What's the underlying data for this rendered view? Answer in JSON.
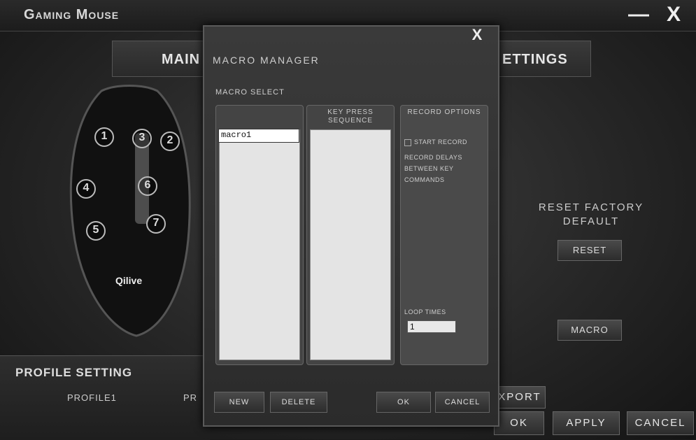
{
  "app": {
    "title": "Gaming Mouse",
    "minimize": "—",
    "close": "X"
  },
  "tabs": [
    {
      "label": "MAIN"
    },
    {
      "label": "ETTINGS"
    }
  ],
  "mouse": {
    "buttons": [
      "1",
      "2",
      "3",
      "4",
      "5",
      "6",
      "7"
    ],
    "brand": "Qilive"
  },
  "profile": {
    "heading": "PROFILE SETTING",
    "items": [
      "PROFILE1",
      "PR"
    ]
  },
  "reset": {
    "label_line1": "RESET FACTORY",
    "label_line2": "DEFAULT",
    "button": "RESET",
    "macro_button": "MACRO"
  },
  "bottom": {
    "export": "XPORT",
    "ok": "OK",
    "apply": "APPLY",
    "cancel": "CANCEL"
  },
  "dialog": {
    "close": "X",
    "title": "MACRO MANAGER",
    "macro_select": "MACRO SELECT",
    "macro_name": "macro1",
    "col2_head": "KEY PRESS SEQUENCE",
    "col3_head": "RECORD OPTIONS",
    "start_record": "START RECORD",
    "record_delay": "RECORD DELAYS",
    "between": "BETWEEN KEY",
    "commands": "COMMANDS",
    "loop_times": "LOOP TIMES",
    "loop_value": "1",
    "new": "NEW",
    "delete": "DELETE",
    "ok": "OK",
    "cancel": "CANCEL"
  }
}
